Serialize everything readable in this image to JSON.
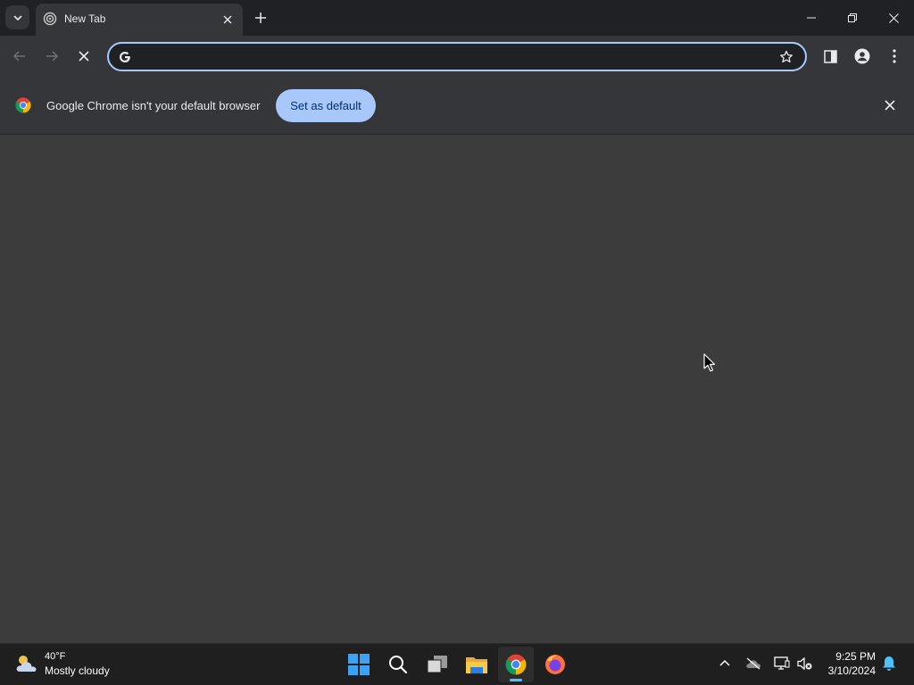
{
  "browser": {
    "tab": {
      "title": "New Tab"
    },
    "omnibox": {
      "value": "",
      "placeholder": ""
    },
    "infobar": {
      "message": "Google Chrome isn't your default browser",
      "button_label": "Set as default"
    }
  },
  "taskbar": {
    "weather": {
      "temperature": "40°F",
      "condition": "Mostly cloudy"
    },
    "clock": {
      "time": "9:25 PM",
      "date": "3/10/2024"
    }
  },
  "colors": {
    "accent": "#a8c7fa",
    "taskbar_active": "#4cc2ff",
    "content_bg": "#3c3c3c"
  }
}
